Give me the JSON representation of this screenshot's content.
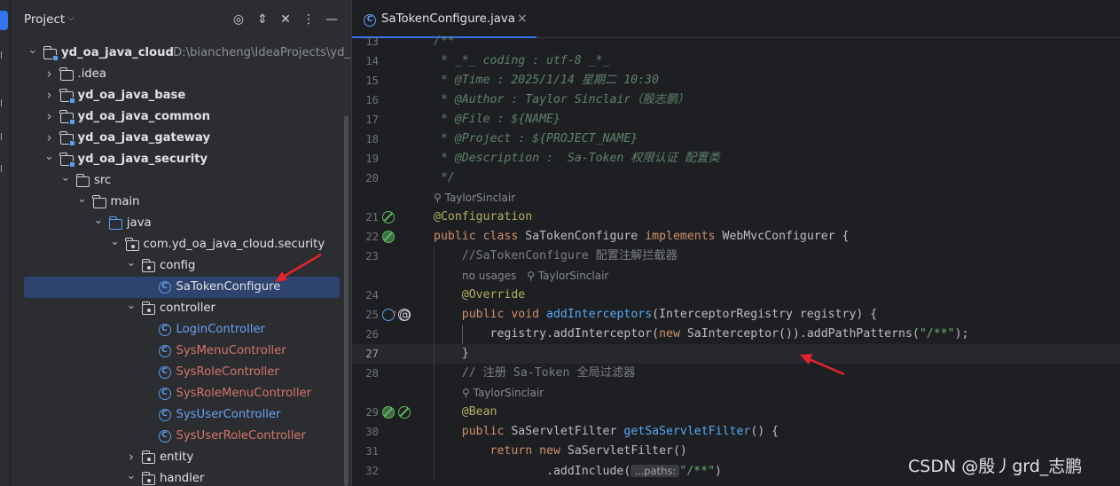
{
  "project_panel": {
    "title": "Project",
    "header_icons": [
      "crosshair-icon",
      "expand-collapse-icon",
      "collapse-all-icon",
      "more-icon",
      "minimize-icon"
    ],
    "tree": [
      {
        "label": "yd_oa_java_cloud",
        "path": "D:\\biancheng\\IdeaProjects\\yd_oa_j",
        "kind": "module",
        "expanded": true
      },
      {
        "label": ".idea",
        "kind": "folder",
        "expanded": false
      },
      {
        "label": "yd_oa_java_base",
        "kind": "module",
        "expanded": false
      },
      {
        "label": "yd_oa_java_common",
        "kind": "module",
        "expanded": false
      },
      {
        "label": "yd_oa_java_gateway",
        "kind": "module",
        "expanded": false
      },
      {
        "label": "yd_oa_java_security",
        "kind": "module",
        "expanded": true
      },
      {
        "label": "src",
        "kind": "folder",
        "expanded": true
      },
      {
        "label": "main",
        "kind": "folder",
        "expanded": true
      },
      {
        "label": "java",
        "kind": "source-folder",
        "expanded": true
      },
      {
        "label": "com.yd_oa_java_cloud.security",
        "kind": "package",
        "expanded": true
      },
      {
        "label": "config",
        "kind": "package",
        "expanded": true
      },
      {
        "label": "SaTokenConfigure",
        "kind": "class",
        "selected": true
      },
      {
        "label": "controller",
        "kind": "package",
        "expanded": true
      },
      {
        "label": "LoginController",
        "kind": "class",
        "status": "added"
      },
      {
        "label": "SysMenuController",
        "kind": "class",
        "status": "unversioned"
      },
      {
        "label": "SysRoleController",
        "kind": "class",
        "status": "unversioned"
      },
      {
        "label": "SysRoleMenuController",
        "kind": "class",
        "status": "unversioned"
      },
      {
        "label": "SysUserController",
        "kind": "class",
        "status": "added"
      },
      {
        "label": "SysUserRoleController",
        "kind": "class",
        "status": "unversioned"
      },
      {
        "label": "entity",
        "kind": "package",
        "expanded": false
      },
      {
        "label": "handler",
        "kind": "package",
        "expanded": true
      }
    ]
  },
  "editor": {
    "tab_label": "SaTokenConfigure.java",
    "tab_close": "×",
    "lines": [
      {
        "n": "13",
        "segs": [
          [
            "cmt",
            "/**"
          ]
        ]
      },
      {
        "n": "14",
        "segs": [
          [
            "cmt",
            " * _*_ coding : utf-8 _*_"
          ]
        ]
      },
      {
        "n": "15",
        "segs": [
          [
            "cmt",
            " * @Time : 2025/1/14 星期二 10:30"
          ]
        ]
      },
      {
        "n": "16",
        "segs": [
          [
            "cmt",
            " * @Author : Taylor Sinclair（殷志鹏）"
          ]
        ]
      },
      {
        "n": "17",
        "segs": [
          [
            "cmt",
            " * @File : ${NAME}"
          ]
        ]
      },
      {
        "n": "18",
        "segs": [
          [
            "cmt",
            " * @Project : ${PROJECT_NAME}"
          ]
        ]
      },
      {
        "n": "19",
        "segs": [
          [
            "cmt",
            " * @Description :  Sa-Token 权限认证 配置类"
          ]
        ]
      },
      {
        "n": "20",
        "segs": [
          [
            "cmt",
            " */"
          ]
        ]
      },
      {
        "hint": "TaylorSinclair",
        "hint_prefix": "",
        "indent": 0
      },
      {
        "n": "21",
        "segs": [
          [
            "ann",
            "@Configuration"
          ]
        ]
      },
      {
        "n": "22",
        "segs": [
          [
            "kw",
            "public class "
          ],
          [
            "plain",
            "SaTokenConfigure "
          ],
          [
            "kw",
            "implements "
          ],
          [
            "plain",
            "WebMvcConfigurer {"
          ]
        ]
      },
      {
        "n": "23",
        "segs": [
          [
            "plain",
            "    "
          ],
          [
            "cmt-ln",
            "//SaTokenConfigure 配置注解拦截器"
          ]
        ]
      },
      {
        "hint": "TaylorSinclair",
        "hint_prefix": "no usages",
        "indent": 1
      },
      {
        "n": "24",
        "segs": [
          [
            "plain",
            "    "
          ],
          [
            "ann",
            "@Override"
          ]
        ]
      },
      {
        "n": "25",
        "segs": [
          [
            "plain",
            "    "
          ],
          [
            "kw",
            "public void "
          ],
          [
            "fn",
            "addInterceptors"
          ],
          [
            "plain",
            "(InterceptorRegistry registry) {"
          ]
        ]
      },
      {
        "n": "26",
        "segs": [
          [
            "plain",
            "        registry.addInterceptor("
          ],
          [
            "kw",
            "new "
          ],
          [
            "plain",
            "SaInterceptor()).addPathPatterns("
          ],
          [
            "str",
            "\"/**\""
          ],
          [
            "plain",
            ");"
          ]
        ]
      },
      {
        "n": "27",
        "segs": [
          [
            "plain",
            "    }"
          ]
        ],
        "current": true
      },
      {
        "n": "28",
        "segs": [
          [
            "plain",
            "    "
          ],
          [
            "cmt-ln",
            "// 注册 Sa-Token 全局过滤器"
          ]
        ]
      },
      {
        "hint": "TaylorSinclair",
        "hint_prefix": "",
        "indent": 1
      },
      {
        "n": "29",
        "segs": [
          [
            "plain",
            "    "
          ],
          [
            "ann",
            "@Bean"
          ]
        ]
      },
      {
        "n": "30",
        "segs": [
          [
            "plain",
            "    "
          ],
          [
            "kw",
            "public "
          ],
          [
            "plain",
            "SaServletFilter "
          ],
          [
            "fn",
            "getSaServletFilter"
          ],
          [
            "plain",
            "() {"
          ]
        ]
      },
      {
        "n": "31",
        "segs": [
          [
            "plain",
            "        "
          ],
          [
            "kw",
            "return new "
          ],
          [
            "plain",
            "SaServletFilter()"
          ]
        ]
      },
      {
        "n": "32",
        "segs": [
          [
            "plain",
            "                .addInclude("
          ],
          [
            "inlay",
            "...paths:"
          ],
          [
            "str",
            "\"/**\""
          ],
          [
            "plain",
            ")"
          ]
        ]
      }
    ]
  },
  "watermark": "CSDN @殷丿grd_志鹏",
  "colors": {
    "selection": "#2e436e",
    "accent": "#3574f0",
    "arrow": "#e8222b",
    "added": "#6aa0f7",
    "unversioned": "#d5756c"
  }
}
